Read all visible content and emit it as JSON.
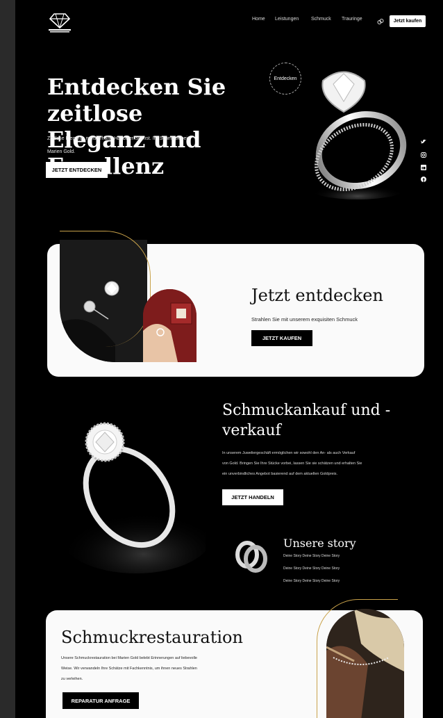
{
  "header": {
    "nav": [
      "Home",
      "Leistungen",
      "Schmuck",
      "Trauringe"
    ],
    "cta": "Jetzt kaufen"
  },
  "hero": {
    "title_line1": "Entdecken Sie zeitlose",
    "title_line2": "Eleganz und Exzellenz",
    "subtitle_line1": "Zeitlose Eleganz, meisterhafte Handwerkskunst. Ihr Schmuck bei",
    "subtitle_line2": "Marien Gold.",
    "button": "JETZT ENTDECKEN",
    "badge": "Entdecken"
  },
  "social": [
    "twitter-icon",
    "instagram-icon",
    "linkedin-icon",
    "facebook-icon"
  ],
  "discover": {
    "title": "Jetzt entdecken",
    "text": "Strahlen Sie mit unserem exquisiten Schmuck",
    "button": "JETZT KAUFEN"
  },
  "trade": {
    "title_line1": "Schmuckankauf und -",
    "title_line2": "verkauf",
    "text_line1": "In unserem Juweliergeschäft ermöglichen wir sowohl den An- als auch Verkauf",
    "text_line2": "von Gold. Bringen Sie Ihre Stücke vorbei, lassen Sie sie schätzen und erhalten Sie",
    "text_line3": "ein unverbindliches Angebot basierend auf dem aktuellen Goldpreis.",
    "button": "JETZT HANDELN"
  },
  "story": {
    "title": "Unsere story",
    "lines": [
      "Deine Story Deine Story Deine Story",
      "Deine Story Deine Story Deine Story",
      "Deine Story Deine Story Deine Story"
    ]
  },
  "restoration": {
    "title": "Schmuckrestauration",
    "text_line1": "Unsere Schmuckrestauration bei Marien Gold belebt Erinnerungen auf liebevolle",
    "text_line2": "Weise. Wir verwandeln Ihre Schätze mit Fachkenntnis, um ihnen neues Strahlen",
    "text_line3": "zu verleihen.",
    "button": "REPARATUR ANFRAGE"
  },
  "colors": {
    "accent_gold": "#c9a24a",
    "background": "#000000",
    "card": "#fafafa"
  }
}
